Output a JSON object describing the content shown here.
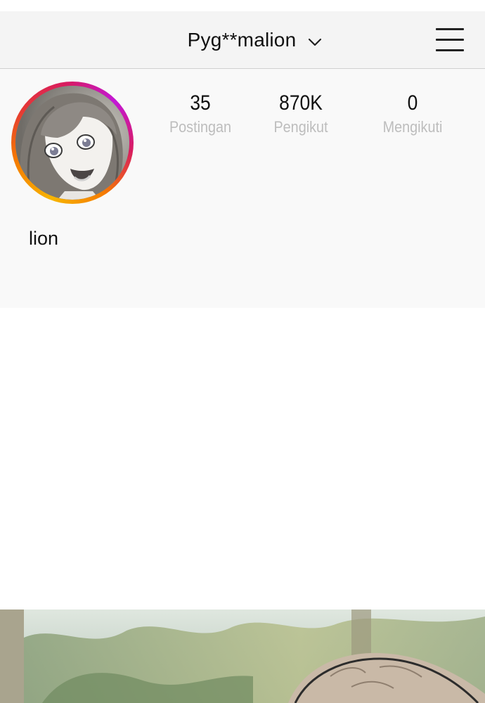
{
  "header": {
    "username": "Pyg**malion",
    "dropdown_icon": "chevron-down-icon",
    "menu_icon": "hamburger-menu-icon"
  },
  "profile": {
    "stats": [
      {
        "count": "35",
        "label": "Postingan"
      },
      {
        "count": "870K",
        "label": "Pengikut"
      },
      {
        "count": "0",
        "label": "Mengikuti"
      }
    ],
    "display_name": "lion",
    "avatar_ring_colors": [
      "#f7b500",
      "#f57c00",
      "#e53935",
      "#d81b60",
      "#c218d6"
    ]
  },
  "colors": {
    "header_bg": "#f4f4f4",
    "profile_bg": "#f9f9f9",
    "label_gray": "#bdbdbd"
  }
}
